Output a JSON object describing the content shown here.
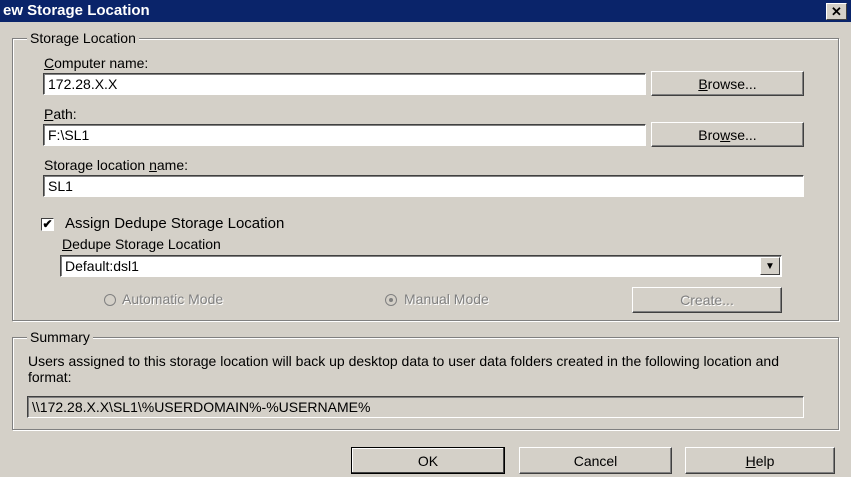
{
  "window": {
    "title": "ew Storage Location",
    "close_glyph": "✕"
  },
  "storage_group": {
    "legend": "Storage Location",
    "computer_name": {
      "label_pre": "",
      "label_u": "C",
      "label_post": "omputer name:",
      "value": "172.28.X.X",
      "browse_pre": "",
      "browse_u": "B",
      "browse_post": "rowse..."
    },
    "path": {
      "label_pre": "",
      "label_u": "P",
      "label_post": "ath:",
      "value": "F:\\SL1",
      "browse_pre": "Bro",
      "browse_u": "w",
      "browse_post": "se..."
    },
    "location_name": {
      "label_pre": "Storage location ",
      "label_u": "n",
      "label_post": "ame:",
      "value": "SL1"
    },
    "assign_dedupe": {
      "label": "Assign Dedupe Storage Location",
      "checked": true,
      "check_glyph": "✔"
    },
    "dedupe_location": {
      "label_pre": "",
      "label_u": "D",
      "label_post": "edupe Storage Location",
      "value": "Default:dsl1",
      "arrow_glyph": "▼"
    },
    "automatic_mode": {
      "label": "Automatic Mode",
      "selected": false
    },
    "manual_mode": {
      "label": "Manual Mode",
      "selected": true
    },
    "create_label": "Create..."
  },
  "summary_group": {
    "legend": "Summary",
    "text": "Users assigned to this storage location will back up desktop data to user data folders created in the following location and format:",
    "path_value": "\\\\172.28.X.X\\SL1\\%USERDOMAIN%-%USERNAME%"
  },
  "buttons": {
    "ok": "OK",
    "cancel": "Cancel",
    "help_u": "H",
    "help_post": "elp"
  }
}
